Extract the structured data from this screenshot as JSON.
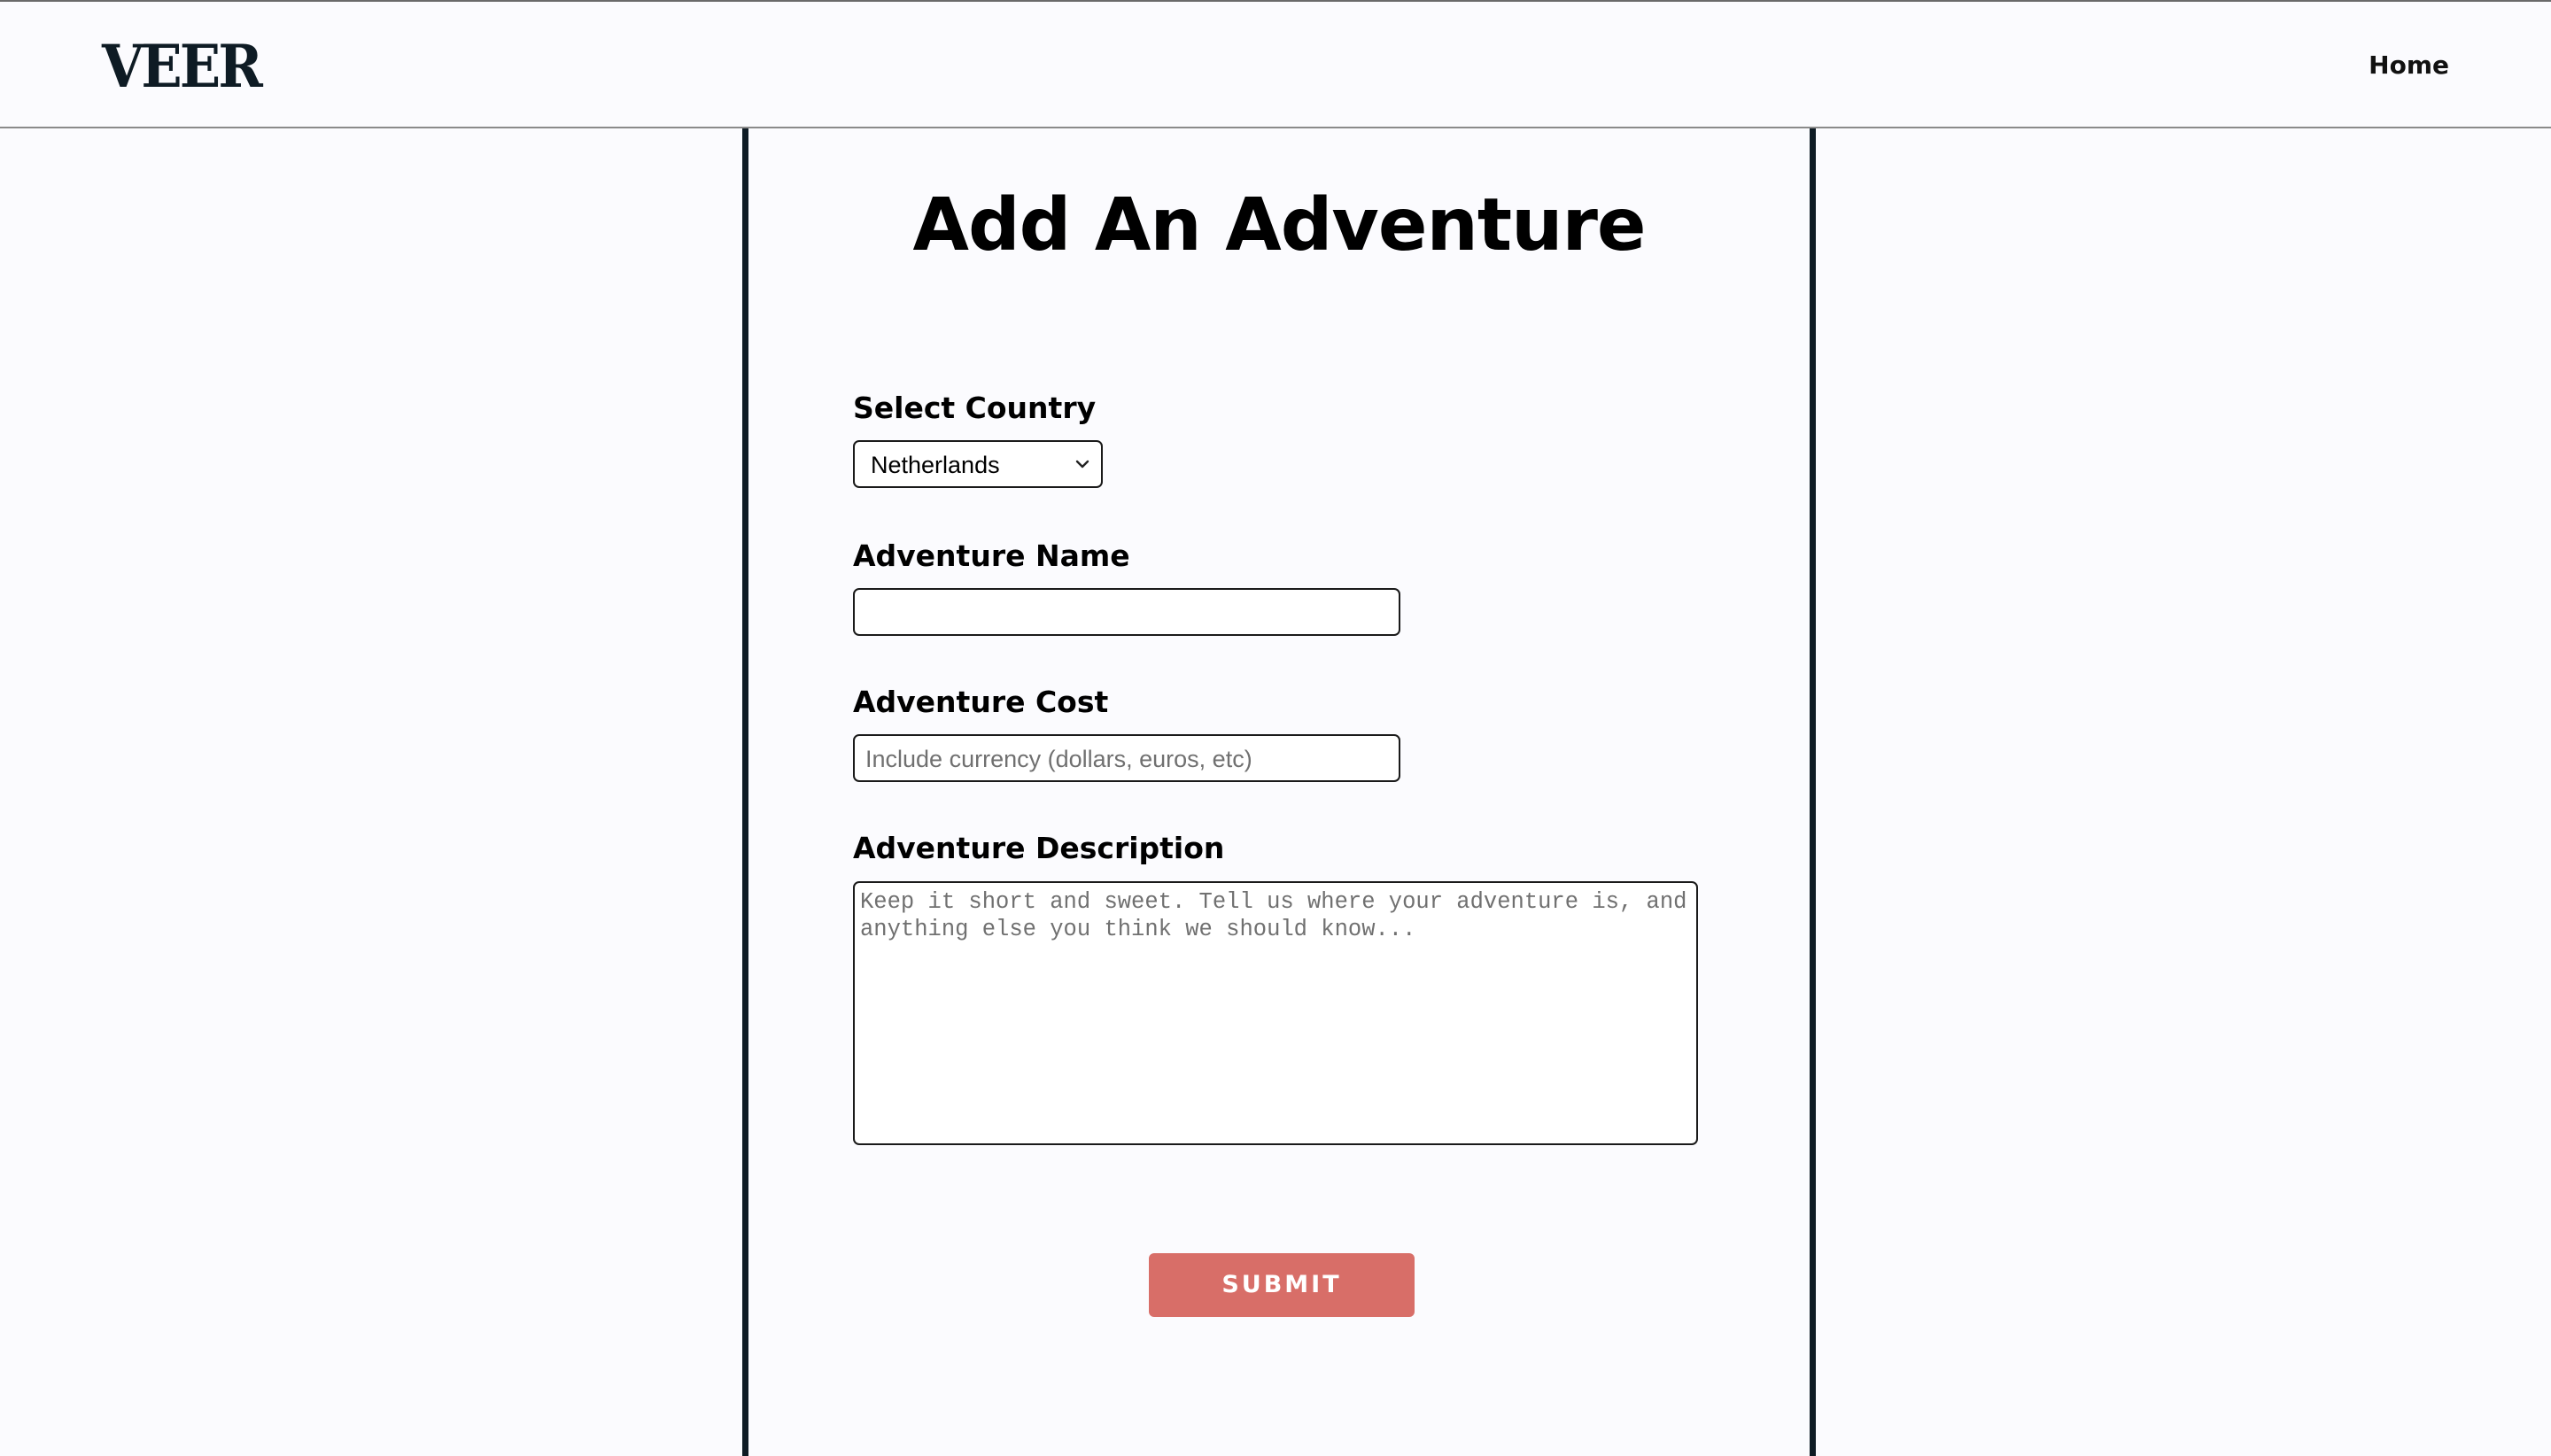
{
  "header": {
    "logo": "VEER",
    "nav_home": "Home"
  },
  "form": {
    "title": "Add An Adventure",
    "country": {
      "label": "Select Country",
      "selected": "Netherlands"
    },
    "name": {
      "label": "Adventure Name",
      "value": "",
      "placeholder": ""
    },
    "cost": {
      "label": "Adventure Cost",
      "value": "",
      "placeholder": "Include currency (dollars, euros, etc)"
    },
    "description": {
      "label": "Adventure Description",
      "value": "",
      "placeholder": "Keep it short and sweet. Tell us where your adventure is, and anything else you think we should know..."
    },
    "submit_label": "SUBMIT"
  },
  "icons": {
    "select_chevron": "chevron-down-icon"
  },
  "colors": {
    "background": "#fbfbfe",
    "panel_border": "#0e1b24",
    "submit_button": "#d86e68",
    "logo": "#0e1b24"
  }
}
